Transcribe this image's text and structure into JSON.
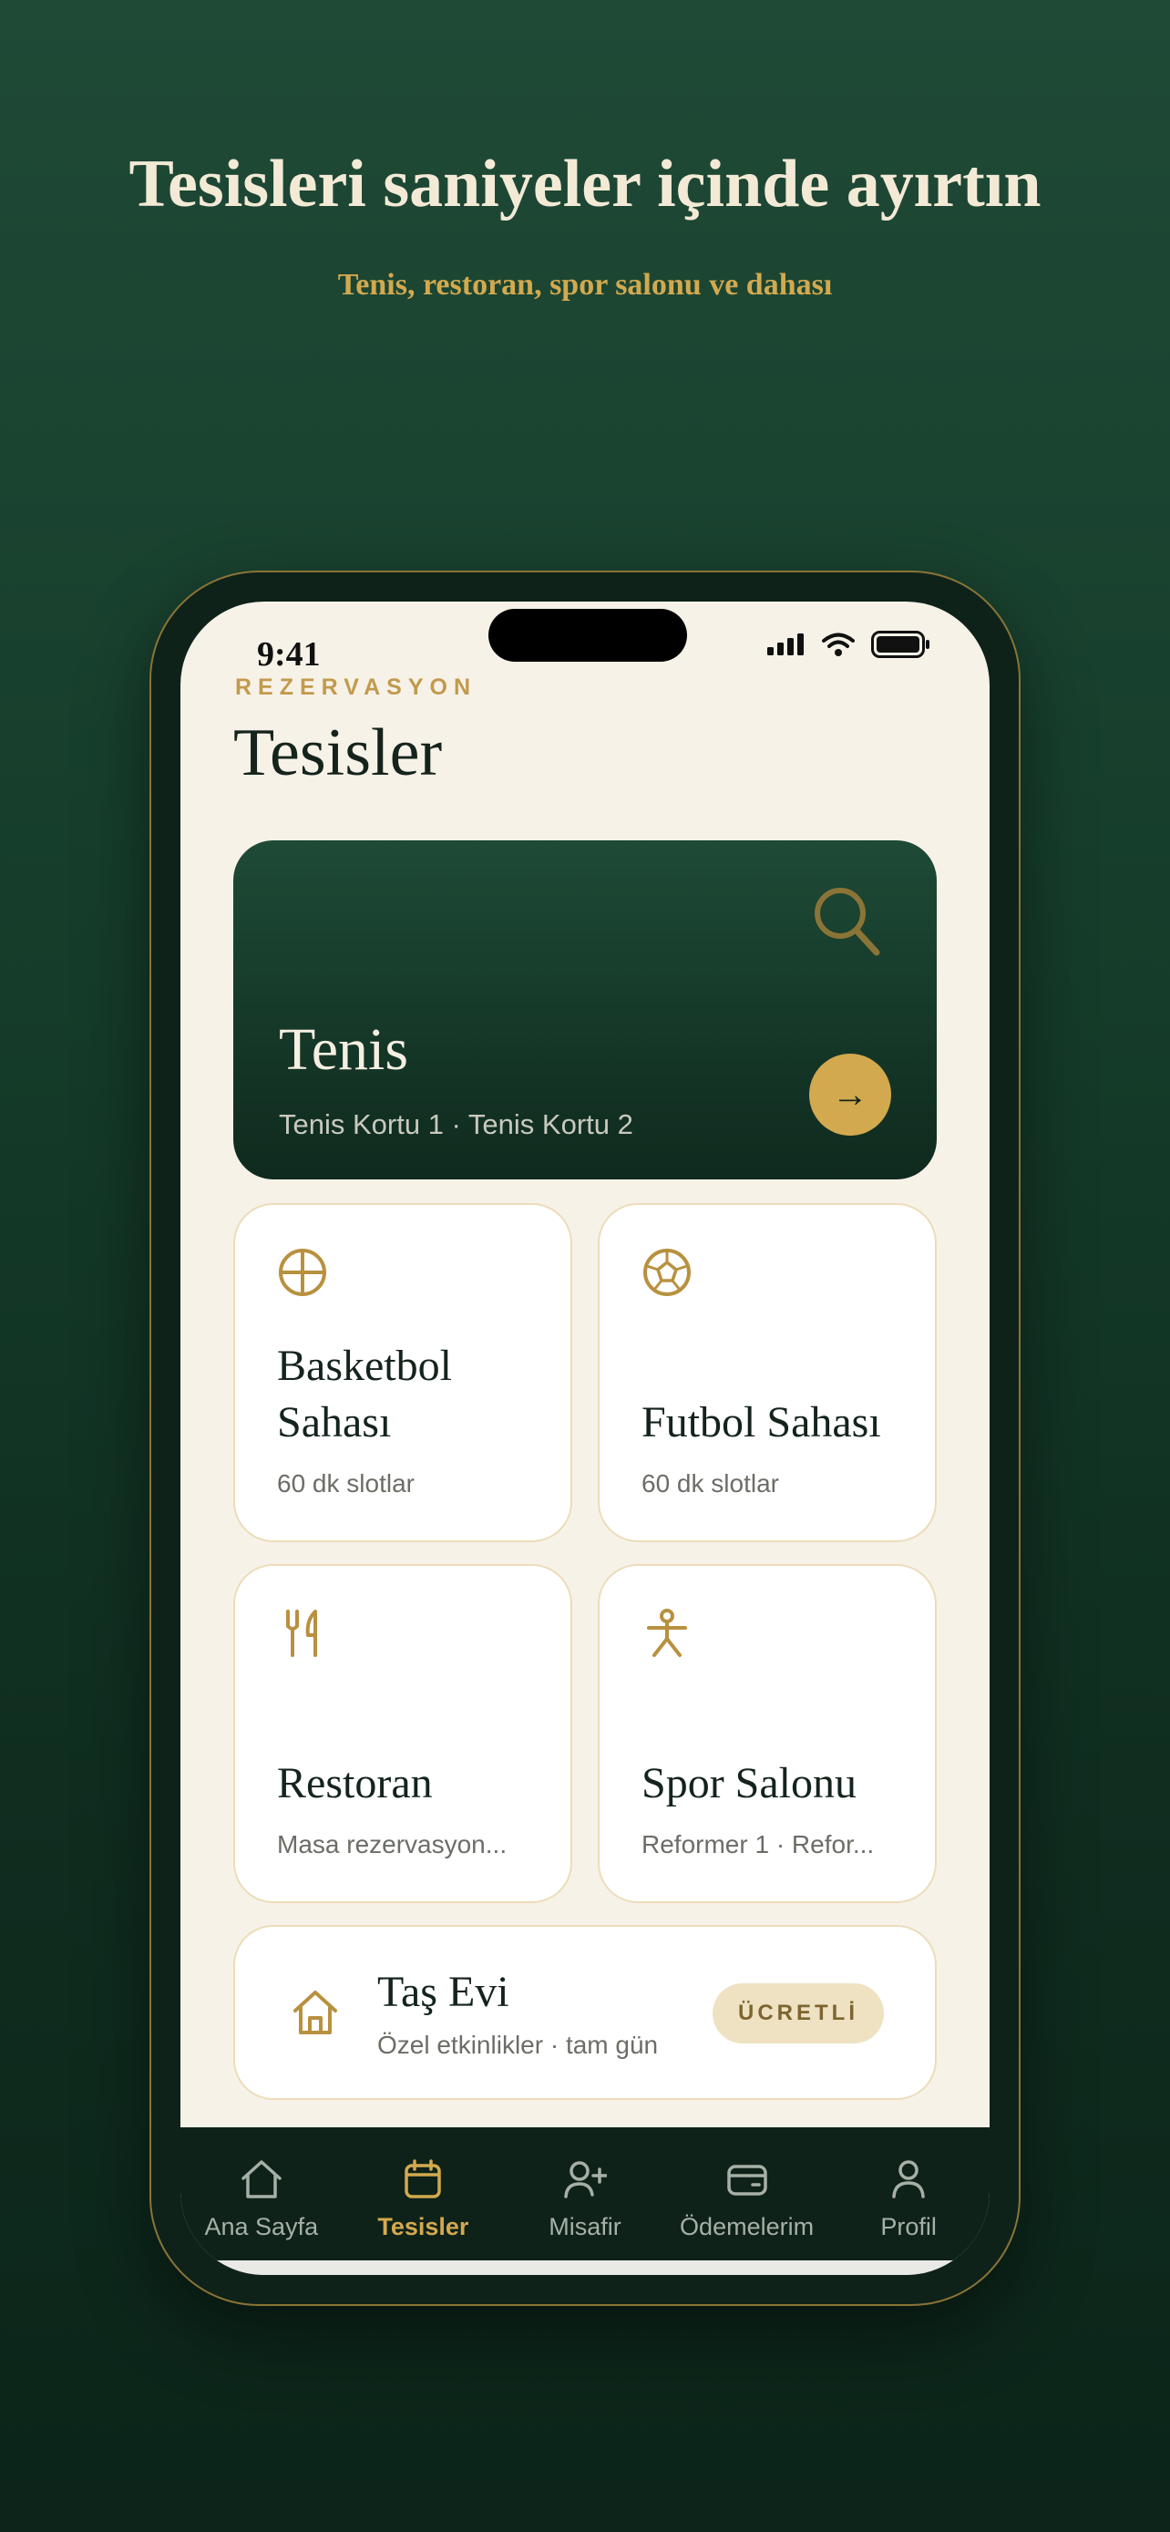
{
  "promo": {
    "headline": "Tesisleri saniyeler içinde ayırtın",
    "subline": "Tenis, restoran, spor salonu ve dahası"
  },
  "status_bar": {
    "time": "9:41"
  },
  "header": {
    "eyebrow": "REZERVASYON",
    "title": "Tesisler"
  },
  "hero": {
    "title": "Tenis",
    "subtitle": "Tenis Kortu 1 · Tenis Kortu 2",
    "arrow": "→"
  },
  "cards": [
    {
      "title": "Basketbol Sahası",
      "subtitle": "60 dk slotlar",
      "icon": "basketball-icon"
    },
    {
      "title": "Futbol Sahası",
      "subtitle": "60 dk slotlar",
      "icon": "soccer-ball-icon"
    },
    {
      "title": "Restoran",
      "subtitle": "Masa rezervasyon...",
      "icon": "fork-knife-icon"
    },
    {
      "title": "Spor Salonu",
      "subtitle": "Reformer 1 · Refor...",
      "icon": "gym-person-icon"
    }
  ],
  "wide_card": {
    "title": "Taş Evi",
    "subtitle": "Özel etkinlikler · tam gün",
    "badge": "ÜCRETLİ",
    "icon": "house-icon"
  },
  "tabs": [
    {
      "label": "Ana Sayfa",
      "icon": "home-icon",
      "active": false
    },
    {
      "label": "Tesisler",
      "icon": "calendar-icon",
      "active": true
    },
    {
      "label": "Misafir",
      "icon": "add-user-icon",
      "active": false
    },
    {
      "label": "Ödemelerim",
      "icon": "wallet-icon",
      "active": false
    },
    {
      "label": "Profil",
      "icon": "profile-icon",
      "active": false
    }
  ],
  "colors": {
    "background": "#163d2b",
    "accent_gold": "#d3a94f",
    "screen_bg": "#f7f2e8",
    "tabbar_bg": "#0e2219"
  }
}
